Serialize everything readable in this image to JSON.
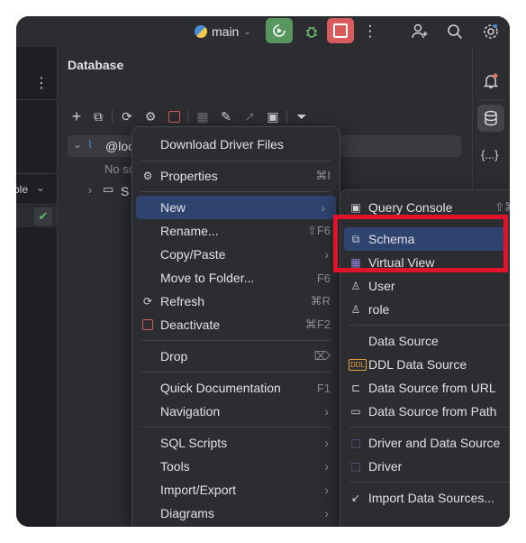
{
  "toolbar": {
    "branch": "main",
    "icons": [
      "run-icon",
      "debug-icon",
      "stop-icon",
      "more-icon",
      "add-user-icon",
      "search-icon",
      "settings-icon"
    ]
  },
  "colors": {
    "run": "#57965c",
    "stop": "#d95c5c",
    "selection": "#2e436e",
    "highlight": "#e0132a"
  },
  "left_pane": {
    "menu": "⋮",
    "column_label": "ole"
  },
  "database_pane": {
    "title": "Database",
    "tree": {
      "root": "@loc",
      "no_schemas": "No sc",
      "schemas_label": "S"
    }
  },
  "context_menu": {
    "items": [
      {
        "label": "Download Driver Files",
        "shortcut": ""
      },
      {
        "label": "Properties",
        "shortcut": "⌘I"
      },
      {
        "label": "New",
        "shortcut": ""
      },
      {
        "label": "Rename...",
        "shortcut": "⇧F6"
      },
      {
        "label": "Copy/Paste",
        "shortcut": ""
      },
      {
        "label": "Move to Folder...",
        "shortcut": "F6"
      },
      {
        "label": "Refresh",
        "shortcut": "⌘R"
      },
      {
        "label": "Deactivate",
        "shortcut": "⌘F2"
      },
      {
        "label": "Drop",
        "shortcut": "⌦"
      },
      {
        "label": "Quick Documentation",
        "shortcut": "F1"
      },
      {
        "label": "Navigation",
        "shortcut": ""
      },
      {
        "label": "SQL Scripts",
        "shortcut": ""
      },
      {
        "label": "Tools",
        "shortcut": ""
      },
      {
        "label": "Import/Export",
        "shortcut": ""
      },
      {
        "label": "Diagrams",
        "shortcut": ""
      }
    ]
  },
  "submenu": {
    "items": [
      {
        "label": "Query Console",
        "shortcut": "⇧⌘"
      },
      {
        "label": "Schema",
        "shortcut": ""
      },
      {
        "label": "Virtual View",
        "shortcut": ""
      },
      {
        "label": "User",
        "shortcut": ""
      },
      {
        "label": "role",
        "shortcut": ""
      },
      {
        "label": "Data Source",
        "shortcut": ""
      },
      {
        "label": "DDL Data Source",
        "shortcut": ""
      },
      {
        "label": "Data Source from URL",
        "shortcut": ""
      },
      {
        "label": "Data Source from Path",
        "shortcut": ""
      },
      {
        "label": "Driver and Data Source",
        "shortcut": ""
      },
      {
        "label": "Driver",
        "shortcut": ""
      },
      {
        "label": "Import Data Sources...",
        "shortcut": ""
      }
    ]
  },
  "right_strip": {
    "json_label": "{...}"
  }
}
